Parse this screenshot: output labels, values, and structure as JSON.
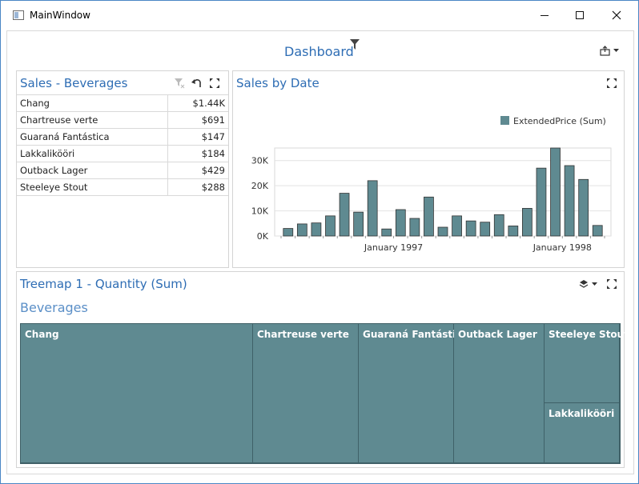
{
  "window": {
    "title": "MainWindow"
  },
  "dashboard": {
    "title": "Dashboard"
  },
  "grid": {
    "title": "Sales - Beverages",
    "rows": [
      {
        "name": "Chang",
        "value": "$1.44K"
      },
      {
        "name": "Chartreuse verte",
        "value": "$691"
      },
      {
        "name": "Guaraná Fantástica",
        "value": "$147"
      },
      {
        "name": "Lakkalikööri",
        "value": "$184"
      },
      {
        "name": "Outback Lager",
        "value": "$429"
      },
      {
        "name": "Steeleye Stout",
        "value": "$288"
      }
    ]
  },
  "chart_panel": {
    "title": "Sales by Date"
  },
  "chart_data": {
    "type": "bar",
    "title": "Sales by Date",
    "xlabel": "",
    "ylabel": "",
    "legend": "ExtendedPrice (Sum)",
    "legend_position": "top-right",
    "color": "#5f8a91",
    "ylim": [
      0,
      35000
    ],
    "y_ticks": [
      "0K",
      "10K",
      "20K",
      "30K"
    ],
    "y_tick_values": [
      0,
      10000,
      20000,
      30000
    ],
    "x_tick_labels": [
      "January 1997",
      "January 1998"
    ],
    "x_tick_index": [
      7.5,
      19.5
    ],
    "grid": true,
    "series": [
      {
        "name": "ExtendedPrice (Sum)",
        "values": [
          3000,
          4800,
          5200,
          8000,
          17000,
          9500,
          22000,
          2800,
          10500,
          7000,
          15500,
          3500,
          8000,
          6000,
          5500,
          8500,
          4000,
          11000,
          27000,
          35000,
          28000,
          22500,
          4200
        ]
      }
    ]
  },
  "treemap": {
    "title": "Treemap 1 - Quantity (Sum)",
    "group": "Beverages",
    "cells": [
      "Chang",
      "Chartreuse verte",
      "Guaraná Fantástica",
      "Outback Lager",
      "Steeleye Stout",
      "Lakkalikööri"
    ]
  }
}
